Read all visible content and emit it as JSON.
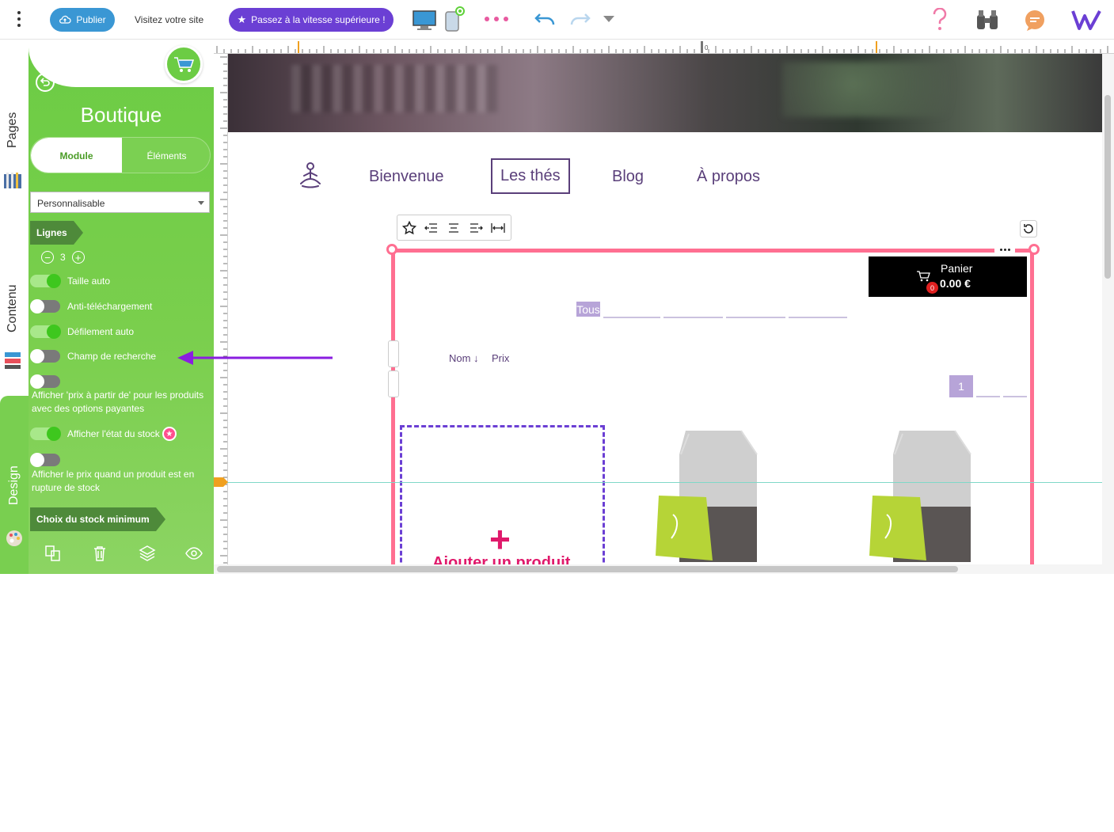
{
  "topbar": {
    "publish_label": "Publier",
    "visit_label": "Visitez votre site",
    "upgrade_label": "Passez à la vitesse supérieure !"
  },
  "ruler": {
    "zero_label": "0"
  },
  "side_tabs": {
    "pages": "Pages",
    "content": "Contenu",
    "design": "Design"
  },
  "panel": {
    "title": "Boutique",
    "tabs": [
      {
        "label": "Module"
      },
      {
        "label": "Éléments"
      }
    ],
    "select_value": "Personnalisable",
    "lines_label": "Lignes",
    "lines_count": "3",
    "toggles": [
      {
        "label": "Taille auto",
        "on": true
      },
      {
        "label": "Anti-téléchargement",
        "on": false
      },
      {
        "label": "Défilement auto",
        "on": true
      },
      {
        "label": "Champ de recherche",
        "on": false
      }
    ],
    "price_from_label": "Afficher 'prix à partir de' pour les produits avec des options payantes",
    "stock_state_label": "Afficher l'état du stock",
    "price_out_of_stock_label": "Afficher le prix quand un produit est en rupture de stock",
    "min_stock_label": "Choix du stock minimum"
  },
  "site": {
    "nav": [
      {
        "label": "Bienvenue"
      },
      {
        "label": "Les thés"
      },
      {
        "label": "Blog"
      },
      {
        "label": "À propos"
      }
    ],
    "cart": {
      "label": "Panier",
      "amount": "0.00 €",
      "count": "0"
    },
    "category_all": "Tous",
    "sort_name": "Nom ↓",
    "sort_price": "Prix",
    "page_number": "1",
    "add_product_label": "Ajouter un produit"
  },
  "colors": {
    "publish": "#3a97d4",
    "upgrade": "#6b3fd4",
    "panel_green": "#6ccc44",
    "module_frame": "#ff6f91",
    "nav_purple": "#5a3f7a",
    "arrow": "#8a1ee0"
  }
}
